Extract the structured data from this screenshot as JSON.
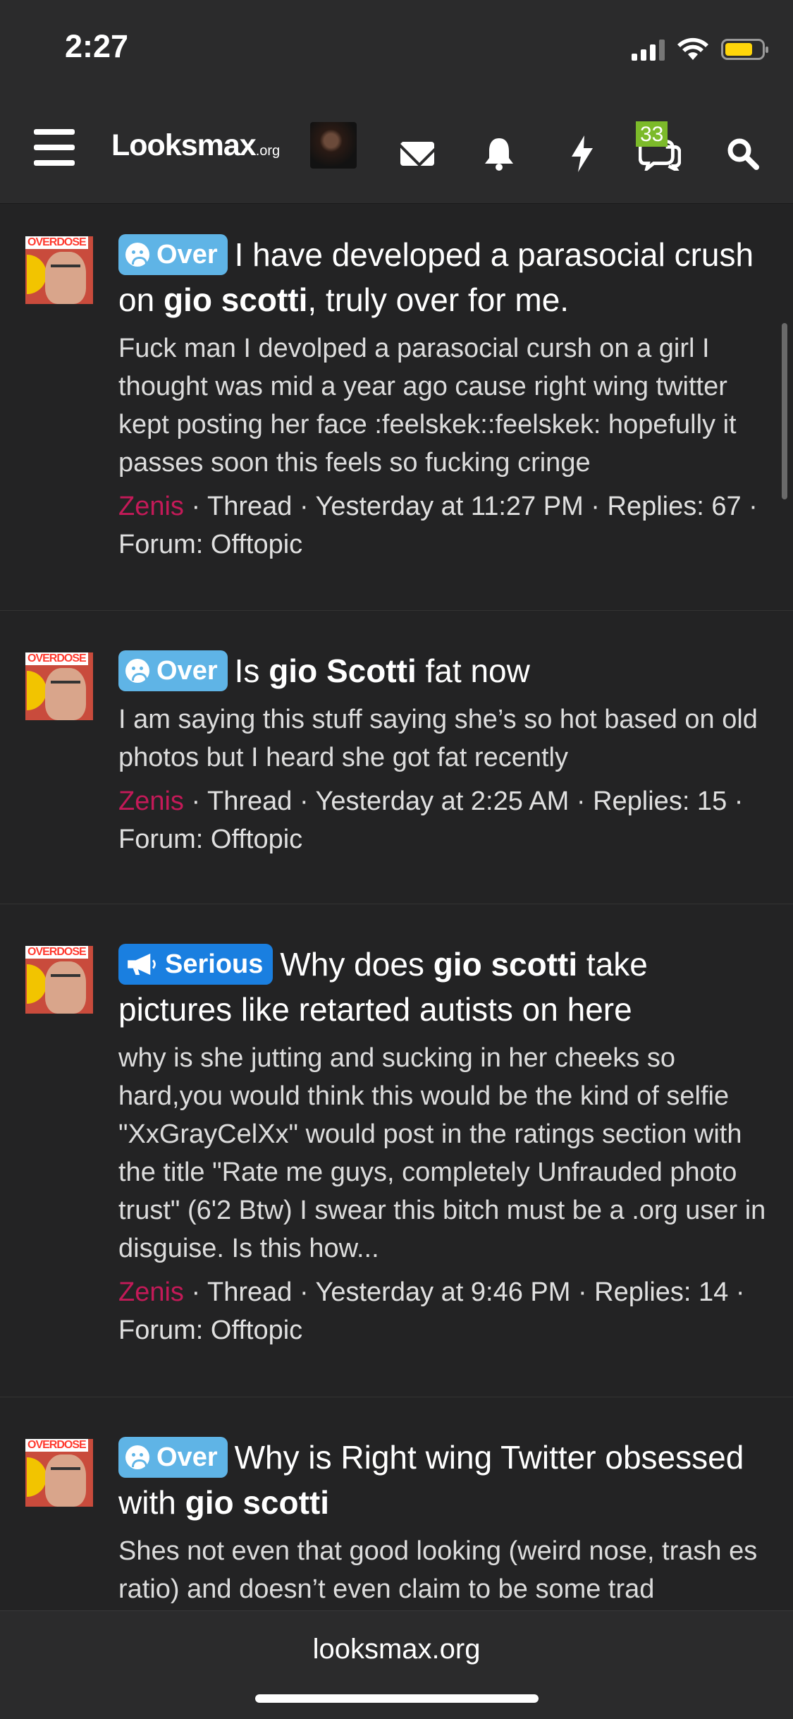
{
  "status_bar": {
    "time": "2:27",
    "battery_level": 0.75,
    "signal_bars": 3
  },
  "header": {
    "logo_main": "Looksmax",
    "logo_suffix": ".org",
    "conversations_count": "33",
    "icons": [
      "menu-icon",
      "mail-icon",
      "bell-icon",
      "lightning-icon",
      "chat-icon",
      "search-icon"
    ]
  },
  "threads": [
    {
      "prefix": "Over",
      "prefix_icon": "sad-face-icon",
      "title_pre": "I have developed a parasocial crush on ",
      "title_bold": "gio scotti",
      "title_post": ", truly over for me.",
      "snippet": "Fuck man I devolped a parasocial cursh on a girl I thought was mid a year ago cause right wing twitter kept posting her face :feelskek::feelskek: hopefully it passes soon this feels so fucking cringe",
      "author": "Zenis",
      "meta": " · Thread · Yesterday at 11:27 PM · Replies: 67 · Forum: Offtopic"
    },
    {
      "prefix": "Over",
      "prefix_icon": "sad-face-icon",
      "title_pre": "Is ",
      "title_bold": "gio Scotti",
      "title_post": " fat now",
      "snippet": "I am saying this stuff saying she’s so hot based on old photos but I heard she got fat recently",
      "author": "Zenis",
      "meta": " · Thread · Yesterday at 2:25 AM · Replies: 15 · Forum: Offtopic"
    },
    {
      "prefix": "Serious",
      "prefix_icon": "megaphone-icon",
      "title_pre": "Why does ",
      "title_bold": "gio scotti",
      "title_post": " take pictures like retarted autists on here",
      "snippet": "why is she jutting and sucking in her cheeks so hard,you would think this would be the kind of selfie \"XxGrayCelXx\" would post in the ratings section with the title \"Rate me guys, completely Unfrauded photo trust\" (6'2 Btw) I swear this bitch must be a .org user in disguise. Is this how...",
      "author": "Zenis",
      "meta": " · Thread · Yesterday at 9:46 PM · Replies: 14 · Forum: Offtopic"
    },
    {
      "prefix": "Over",
      "prefix_icon": "sad-face-icon",
      "title_pre": "Why is Right wing Twitter obsessed with ",
      "title_bold": "gio scotti",
      "title_post": "",
      "snippet": "Shes not even that good looking (weird nose, trash es ratio) and doesn’t even claim to be some trad",
      "author": "",
      "meta": ""
    }
  ],
  "avatar_overlay_text": "OVERDOSE",
  "footer": {
    "url": "looksmax.org"
  }
}
